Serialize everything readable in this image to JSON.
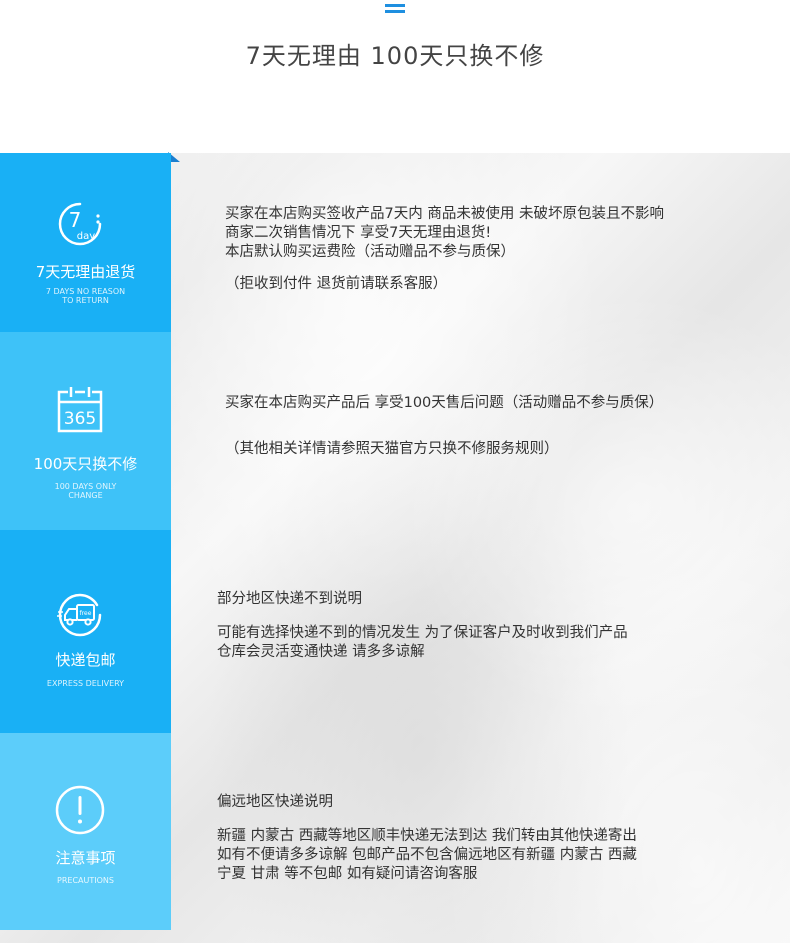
{
  "header": {
    "title": "7天无理由 100天只换不修"
  },
  "sections": [
    {
      "icon": "7-day-icon",
      "icon_text": {
        "number": "7",
        "unit": "day"
      },
      "title": "7天无理由退货",
      "subtitle_lines": [
        "7 DAYS NO REASON",
        "TO RETURN"
      ],
      "lines": [
        "买家在本店购买签收产品7天内 商品未被使用 未破坏原包装且不影响",
        "商家二次销售情况下 享受7天无理由退货!",
        "本店默认购买运费险（活动赠品不参与质保）"
      ],
      "note": "（拒收到付件 退货前请联系客服）"
    },
    {
      "icon": "calendar-365-icon",
      "icon_text": {
        "number": "365"
      },
      "title": "100天只换不修",
      "subtitle_lines": [
        "100 DAYS ONLY",
        "CHANGE"
      ],
      "lines": [
        "买家在本店购买产品后  享受100天售后问题（活动赠品不参与质保）"
      ],
      "note": "（其他相关详情请参照天猫官方只换不修服务规则）"
    },
    {
      "icon": "delivery-truck-icon",
      "icon_text": {
        "badge": "free"
      },
      "title": "快递包邮",
      "subtitle_lines": [
        "EXPRESS DELIVERY"
      ],
      "heading": "部分地区快递不到说明",
      "lines": [
        "可能有选择快递不到的情况发生 为了保证客户及时收到我们产品",
        "仓库会灵活变通快递 请多多谅解"
      ]
    },
    {
      "icon": "exclamation-icon",
      "title": "注意事项",
      "subtitle_lines": [
        "PRECAUTIONS"
      ],
      "heading": "偏远地区快递说明",
      "lines": [
        "新疆 内蒙古 西藏等地区顺丰快递无法到达 我们转由其他快递寄出",
        "如有不便请多多谅解  包邮产品不包含偏远地区有新疆 内蒙古 西藏",
        "宁夏 甘肃 等不包邮 如有疑问请咨询客服"
      ]
    }
  ],
  "colors": {
    "accent": "#1e8fe0",
    "side_primary": "#19b0f5",
    "side_secondary": "#3ec2f8",
    "side_light": "#5ccdfa",
    "text": "#333333"
  }
}
